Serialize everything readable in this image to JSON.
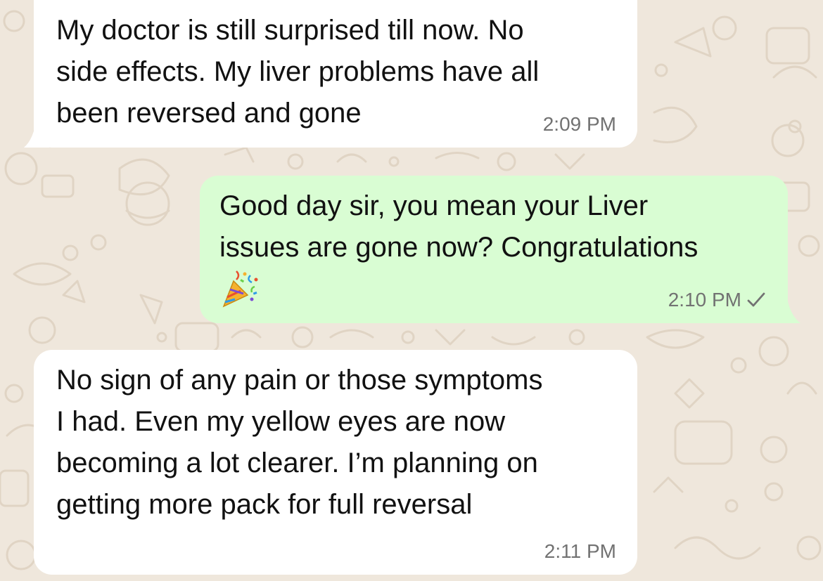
{
  "chat": {
    "wallpaper_color": "#efe7dc",
    "incoming_bubble_color": "#ffffff",
    "outgoing_bubble_color": "#d9fdd3",
    "messages": [
      {
        "direction": "incoming",
        "text": "My doctor is still surprised till now. No\nside effects. My liver problems have all\nbeen reversed and gone",
        "time": "2:09 PM"
      },
      {
        "direction": "outgoing",
        "text": "Good day sir, you mean your Liver\nissues are gone now? Congratulations",
        "emoji": "party-popper-icon",
        "time": "2:10 PM",
        "status": "sent-check-icon"
      },
      {
        "direction": "incoming",
        "text": "No sign of any pain or those symptoms\nI had. Even my yellow eyes are now\nbecoming a lot clearer. I’m planning on\ngetting more pack for full reversal",
        "time": "2:11 PM"
      }
    ]
  }
}
